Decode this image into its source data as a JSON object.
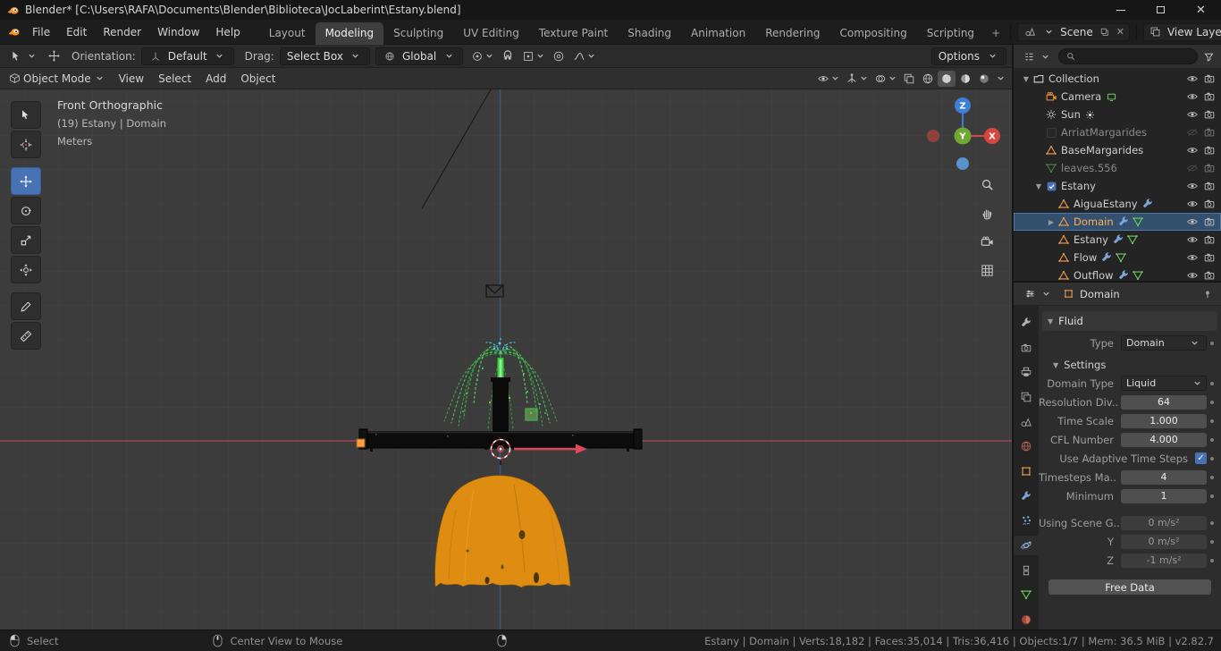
{
  "titlebar": {
    "title": "Blender* [C:\\Users\\RAFA\\Documents\\Blender\\Biblioteca\\JocLaberint\\Estany.blend]",
    "controls": [
      "minimize",
      "maximize",
      "close"
    ]
  },
  "topbar": {
    "menus": [
      "File",
      "Edit",
      "Render",
      "Window",
      "Help"
    ],
    "workspaces": [
      "Layout",
      "Modeling",
      "Sculpting",
      "UV Editing",
      "Texture Paint",
      "Shading",
      "Animation",
      "Rendering",
      "Compositing",
      "Scripting"
    ],
    "active_workspace": "Modeling",
    "add_workspace": "+",
    "scene_label": "Scene",
    "view_layer_label": "View Layer"
  },
  "tool_settings": {
    "orientation_label": "Orientation:",
    "orientation_value": "Default",
    "drag_label": "Drag:",
    "drag_value": "Select Box",
    "transform_space": "Global",
    "options_label": "Options",
    "icons": [
      {
        "name": "pivot-point",
        "chevron": true
      },
      {
        "name": "snap-magnet"
      },
      {
        "name": "snap-target",
        "chevron": true
      },
      {
        "name": "proportional-editing"
      },
      {
        "name": "proportional-falloff",
        "chevron": true
      }
    ]
  },
  "viewport": {
    "mode": "Object Mode",
    "menus": [
      "View",
      "Select",
      "Add",
      "Object"
    ],
    "tools": [
      {
        "name": "select-box"
      },
      {
        "name": "cursor"
      },
      {
        "name": "move",
        "active": true
      },
      {
        "name": "rotate"
      },
      {
        "name": "scale"
      },
      {
        "name": "transform"
      },
      {
        "name": "annotate"
      },
      {
        "name": "measure"
      }
    ],
    "header_icons": [
      {
        "name": "visibility",
        "chevron": true
      },
      {
        "name": "gizmos",
        "chevron": true
      },
      {
        "name": "overlays",
        "chevron": true
      },
      {
        "name": "xray"
      },
      {
        "name": "shading-wireframe"
      },
      {
        "name": "shading-solid",
        "active": true
      },
      {
        "name": "shading-material"
      },
      {
        "name": "shading-rendered"
      },
      {
        "name": "shading-options",
        "chevron": true
      }
    ],
    "overlay": {
      "line1": "Front Orthographic",
      "line2": "(19) Estany | Domain",
      "line3": "Meters"
    },
    "gizmo": {
      "x": "X",
      "y": "Y",
      "z": "Z"
    }
  },
  "outliner": {
    "rows": [
      {
        "name": "Collection",
        "icon": "collection",
        "level": 0,
        "disclosure": "open",
        "right": [
          "eye",
          "camera-render"
        ]
      },
      {
        "name": "Camera",
        "icon": "camera-object",
        "level": 1,
        "extras": [
          "screen"
        ],
        "right": [
          "eye",
          "camera-render"
        ]
      },
      {
        "name": "Sun",
        "icon": "light",
        "level": 1,
        "extras": [
          "sun"
        ],
        "right": [
          "eye",
          "camera-render"
        ]
      },
      {
        "name": "ArriatMargarides",
        "icon": "checkbox-unchecked",
        "level": 1,
        "grayed": true,
        "right": [
          "eye-off",
          "camera-render"
        ]
      },
      {
        "name": "BaseMargarides",
        "icon": "mesh",
        "level": 1,
        "right": [
          "eye",
          "camera-render"
        ]
      },
      {
        "name": "leaves.556",
        "icon": "meshdata",
        "level": 1,
        "grayed": true,
        "right": [
          "eye-off",
          "camera-render"
        ]
      },
      {
        "name": "Estany",
        "icon": "checkbox-checked",
        "level": 1,
        "disclosure": "open",
        "right": [
          "eye",
          "camera-render"
        ]
      },
      {
        "name": "AiguaEstany",
        "icon": "mesh",
        "level": 2,
        "extras": [
          "wrench"
        ],
        "right": [
          "eye",
          "camera-render"
        ]
      },
      {
        "name": "Domain",
        "icon": "mesh",
        "level": 2,
        "disclosure": "closed",
        "selected": true,
        "extras": [
          "wrench",
          "meshdata"
        ],
        "right": [
          "eye",
          "camera-render"
        ]
      },
      {
        "name": "Estany",
        "icon": "mesh",
        "level": 2,
        "extras": [
          "wrench",
          "meshdata"
        ],
        "right": [
          "eye",
          "camera-render"
        ]
      },
      {
        "name": "Flow",
        "icon": "mesh",
        "level": 2,
        "extras": [
          "wrench",
          "meshdata"
        ],
        "right": [
          "eye",
          "camera-render"
        ]
      },
      {
        "name": "Outflow",
        "icon": "mesh",
        "level": 2,
        "extras": [
          "wrench",
          "meshdata"
        ],
        "right": [
          "eye",
          "camera-render"
        ]
      }
    ]
  },
  "properties": {
    "tabs": [
      {
        "name": "tool"
      },
      {
        "name": "render"
      },
      {
        "name": "output"
      },
      {
        "name": "view-layer"
      },
      {
        "name": "scene"
      },
      {
        "name": "world"
      },
      {
        "name": "object"
      },
      {
        "name": "modifiers"
      },
      {
        "name": "particles"
      },
      {
        "name": "physics",
        "active": true
      },
      {
        "name": "constraints"
      },
      {
        "name": "object-data"
      },
      {
        "name": "material"
      }
    ],
    "breadcrumb": "Domain",
    "fluid_panel": "Fluid",
    "type_label": "Type",
    "type_value": "Domain",
    "settings_panel": "Settings",
    "rows": [
      {
        "label": "Domain Type",
        "value": "Liquid",
        "widget": "dropdown"
      },
      {
        "label": "Resolution Div..",
        "value": "64",
        "widget": "field"
      },
      {
        "label": "Time Scale",
        "value": "1.000",
        "widget": "field"
      },
      {
        "label": "CFL Number",
        "value": "4.000",
        "widget": "field"
      },
      {
        "label": "Use Adaptive Time Steps",
        "widget": "checkbox",
        "checked": true
      },
      {
        "label": "Timesteps Ma..",
        "value": "4",
        "widget": "field"
      },
      {
        "label": "Minimum",
        "value": "1",
        "widget": "field"
      },
      {
        "label": "Using Scene G..",
        "value": "0 m/s²",
        "widget": "field",
        "disabled": true,
        "gap_before": true
      },
      {
        "label": "Y",
        "value": "0 m/s²",
        "widget": "field",
        "disabled": true
      },
      {
        "label": "Z",
        "value": "-1 m/s²",
        "widget": "field",
        "disabled": true
      }
    ],
    "free_data": "Free Data"
  },
  "statusbar": {
    "items": [
      {
        "icon": "mouse-left",
        "label": "Select"
      },
      {
        "icon": "mouse-middle",
        "label": "Center View to Mouse"
      },
      {
        "icon": "mouse-right",
        "label": ""
      }
    ],
    "stats": "Estany | Domain | Verts:18,182 | Faces:35,014 | Tris:36,416 | Objects:1/7 | Mem: 36.5 MiB | v2.82.7"
  }
}
